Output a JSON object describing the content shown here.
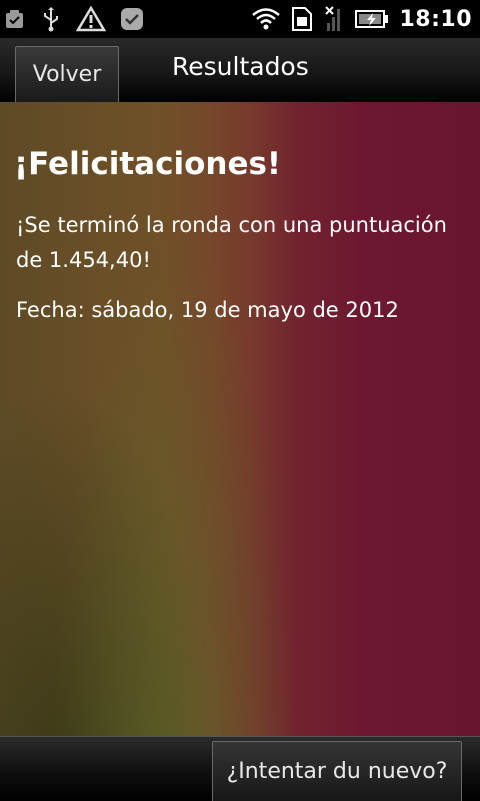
{
  "status_bar": {
    "time": "18:10",
    "left_icons": [
      "checkbox-icon",
      "usb-icon",
      "warning-icon",
      "notification-check-icon"
    ],
    "right_icons": [
      "wifi-icon",
      "sim-icon",
      "no-signal-icon",
      "battery-charging-icon"
    ]
  },
  "title_bar": {
    "back_label": "Volver",
    "title": "Resultados"
  },
  "content": {
    "heading": "¡Felicitaciones!",
    "message": "¡Se terminó la ronda con una puntuación de 1.454,40!",
    "date": "Fecha: sábado, 19 de mayo de 2012"
  },
  "bottom_bar": {
    "retry_label": "¿Intentar du nuevo?"
  },
  "colors": {
    "background_left": "#5e4a26",
    "background_right": "#681530",
    "text": "#ffffff"
  }
}
